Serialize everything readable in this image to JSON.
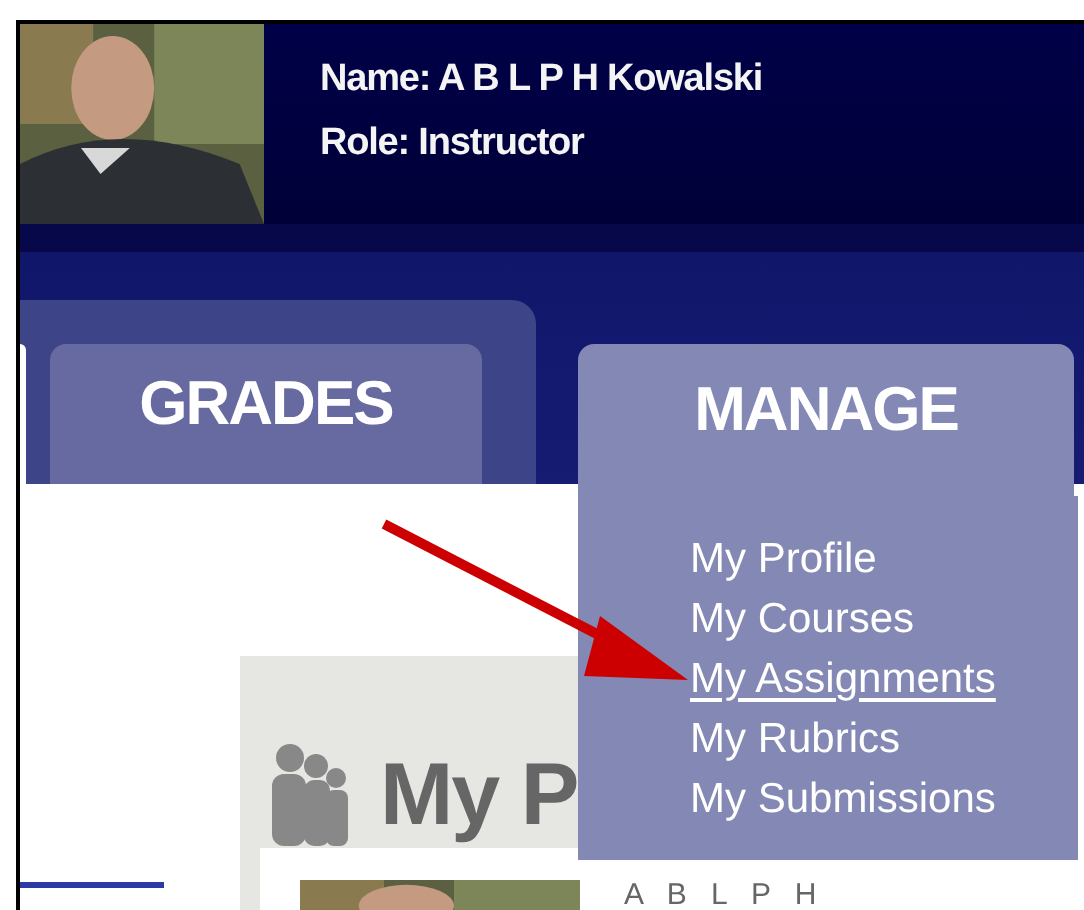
{
  "header": {
    "name": "Name: A B L P H Kowalski",
    "role": "Role: Instructor"
  },
  "tabs": [
    {
      "label": "GRADES",
      "selected": false
    },
    {
      "label": "MANAGE",
      "selected": true
    }
  ],
  "menu": [
    {
      "label": "My Profile",
      "selected": false
    },
    {
      "label": "My Courses",
      "selected": false
    },
    {
      "label": "My Assignments",
      "selected": true
    },
    {
      "label": "My Rubrics",
      "selected": false
    },
    {
      "label": "My Submissions",
      "selected": false
    }
  ],
  "card": {
    "title": "My P",
    "profile_name": "A B L P H"
  }
}
